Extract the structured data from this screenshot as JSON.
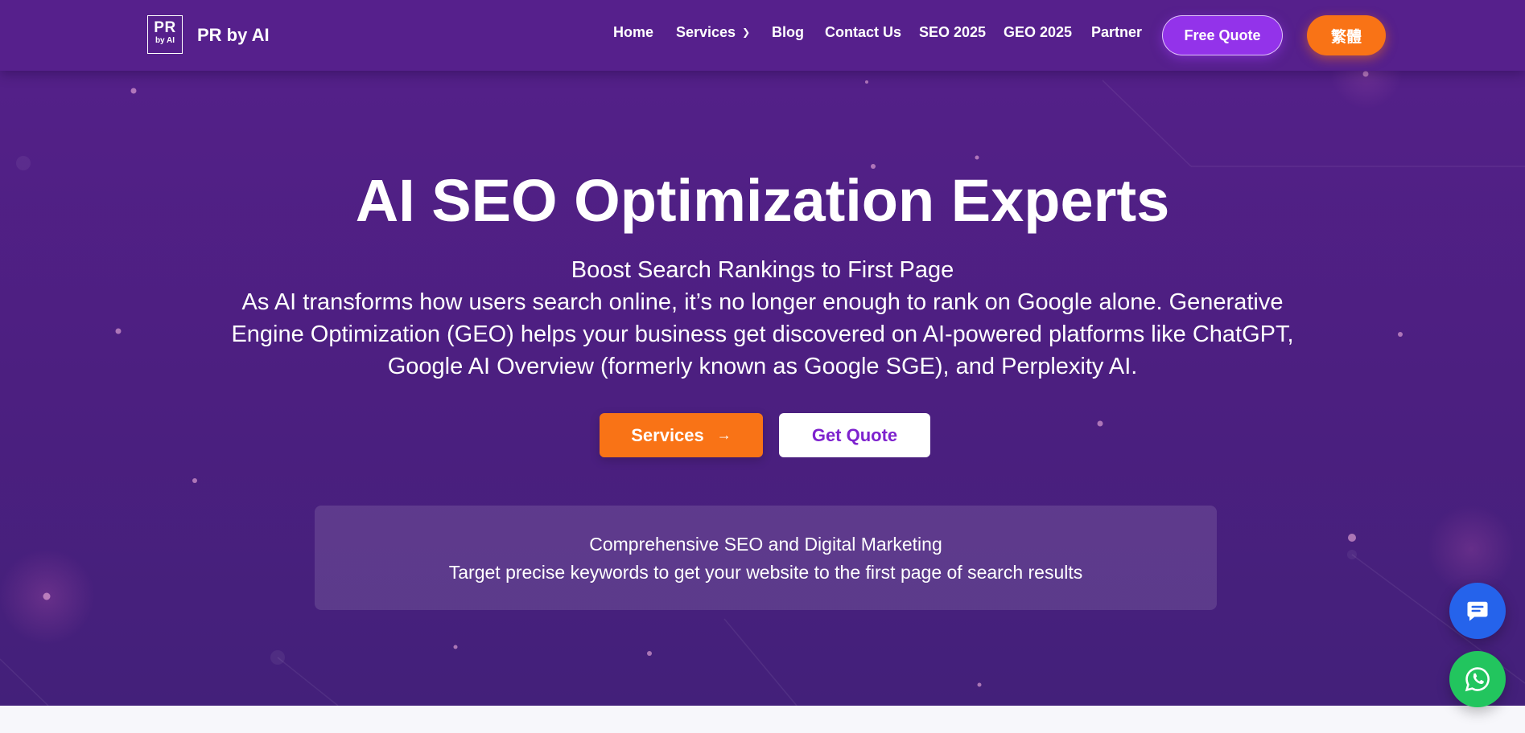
{
  "brand": {
    "logo_top": "PR",
    "logo_bottom": "by AI",
    "name": "PR by AI"
  },
  "nav": {
    "items": [
      {
        "label": "Home"
      },
      {
        "label": "Services",
        "icon": "chevron-down-icon"
      },
      {
        "label": "Blog"
      },
      {
        "label": "Contact Us"
      },
      {
        "label": "SEO 2025"
      },
      {
        "label": "GEO 2025"
      },
      {
        "label": "Partner"
      }
    ],
    "free_quote_label": "Free Quote",
    "language_label": "繁體"
  },
  "hero": {
    "title": "AI SEO Optimization Experts",
    "subtitle": "Boost Search Rankings to First Page",
    "description": "As AI transforms how users search online, it’s no longer enough to rank on Google alone. Generative Engine Optimization (GEO) helps your business get discovered on AI-powered platforms like ChatGPT, Google AI Overview (formerly known as Google SGE), and Perplexity AI.",
    "services_button": "Services",
    "services_button_icon": "arrow-right-icon",
    "quote_button": "Get Quote"
  },
  "info_box": {
    "line1": "Comprehensive SEO and Digital Marketing",
    "line2": "Target precise keywords to get your website to the first page of search results"
  },
  "floating": {
    "chat_icon": "chat-icon",
    "whatsapp_icon": "whatsapp-icon"
  },
  "colors": {
    "hero_background": "#4c1f80",
    "navbar": "#56208c",
    "orange_accent": "#f97316",
    "purple_accent": "#9333ea",
    "chat_blue": "#2563eb",
    "whatsapp_green": "#22c55e"
  }
}
